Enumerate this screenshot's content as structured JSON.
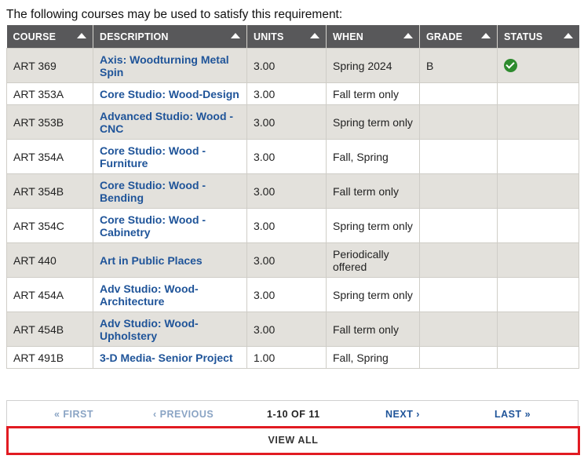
{
  "intro_text": "The following courses may be used to satisfy this requirement:",
  "columns": [
    {
      "label": "COURSE"
    },
    {
      "label": "DESCRIPTION"
    },
    {
      "label": "UNITS"
    },
    {
      "label": "WHEN"
    },
    {
      "label": "GRADE"
    },
    {
      "label": "STATUS"
    }
  ],
  "rows": [
    {
      "course": "ART 369",
      "description": "Axis: Woodturning Metal Spin",
      "units": "3.00",
      "when": "Spring 2024",
      "grade": "B",
      "status_icon": "check-circle-icon"
    },
    {
      "course": "ART 353A",
      "description": "Core Studio: Wood-Design",
      "units": "3.00",
      "when": "Fall term only",
      "grade": "",
      "status_icon": ""
    },
    {
      "course": "ART 353B",
      "description": "Advanced Studio: Wood - CNC",
      "units": "3.00",
      "when": "Spring term only",
      "grade": "",
      "status_icon": ""
    },
    {
      "course": "ART 354A",
      "description": "Core Studio: Wood - Furniture",
      "units": "3.00",
      "when": "Fall, Spring",
      "grade": "",
      "status_icon": ""
    },
    {
      "course": "ART 354B",
      "description": "Core Studio: Wood - Bending",
      "units": "3.00",
      "when": "Fall term only",
      "grade": "",
      "status_icon": ""
    },
    {
      "course": "ART 354C",
      "description": "Core Studio: Wood - Cabinetry",
      "units": "3.00",
      "when": "Spring term only",
      "grade": "",
      "status_icon": ""
    },
    {
      "course": "ART 440",
      "description": "Art in Public Places",
      "units": "3.00",
      "when": "Periodically offered",
      "grade": "",
      "status_icon": ""
    },
    {
      "course": "ART 454A",
      "description": "Adv Studio: Wood-Architecture",
      "units": "3.00",
      "when": "Spring term only",
      "grade": "",
      "status_icon": ""
    },
    {
      "course": "ART 454B",
      "description": "Adv Studio: Wood-Upholstery",
      "units": "3.00",
      "when": "Fall term only",
      "grade": "",
      "status_icon": ""
    },
    {
      "course": "ART 491B",
      "description": "3-D Media- Senior Project",
      "units": "1.00",
      "when": "Fall, Spring",
      "grade": "",
      "status_icon": ""
    }
  ],
  "pager": {
    "first": "« FIRST",
    "previous": "‹ PREVIOUS",
    "count": "1-10 OF 11",
    "next": "NEXT ›",
    "last": "LAST »"
  },
  "view_all": "VIEW ALL",
  "colors": {
    "header_bg": "#58585a",
    "odd_row_bg": "#e3e1dc",
    "link": "#1f5499",
    "disabled_link": "#8aa4c4",
    "status_ok": "#2e8b2e",
    "highlight_border": "#e11b22"
  }
}
